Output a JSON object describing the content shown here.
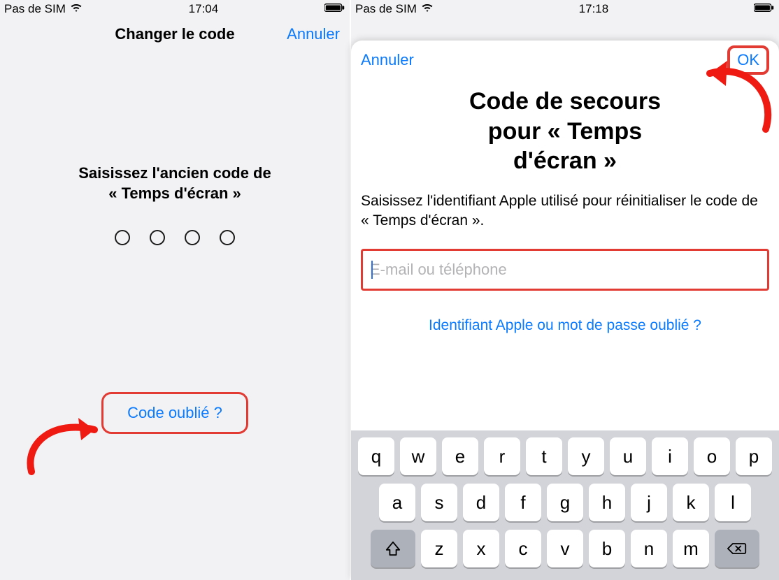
{
  "left": {
    "status": {
      "carrier": "Pas de SIM",
      "time": "17:04"
    },
    "nav": {
      "title": "Changer le code",
      "cancel": "Annuler"
    },
    "instruction_line1": "Saisissez l'ancien code de",
    "instruction_line2": "« Temps d'écran »",
    "forgot": "Code oublié ?"
  },
  "right": {
    "status": {
      "carrier": "Pas de SIM",
      "time": "17:18"
    },
    "sheet": {
      "cancel": "Annuler",
      "ok": "OK",
      "title_line1": "Code de secours",
      "title_line2": "pour « Temps",
      "title_line3": "d'écran »",
      "subtitle": "Saisissez l'identifiant Apple utilisé pour réinitialiser le code de « Temps d'écran ».",
      "placeholder": "E-mail ou téléphone",
      "forgot_id": "Identifiant Apple ou mot de passe oublié ?"
    },
    "keyboard": {
      "row1": [
        "q",
        "w",
        "e",
        "r",
        "t",
        "y",
        "u",
        "i",
        "o",
        "p"
      ],
      "row2": [
        "a",
        "s",
        "d",
        "f",
        "g",
        "h",
        "j",
        "k",
        "l"
      ],
      "row3": [
        "z",
        "x",
        "c",
        "v",
        "b",
        "n",
        "m"
      ]
    }
  }
}
